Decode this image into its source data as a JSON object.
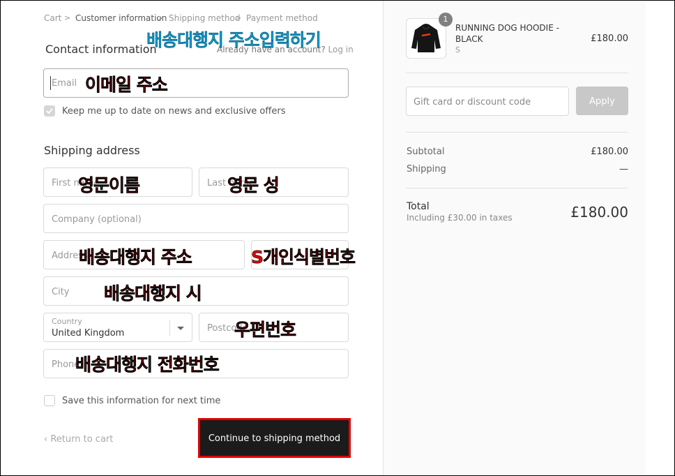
{
  "breadcrumb": {
    "items": [
      "Cart",
      "Customer information",
      "Shipping method",
      "Payment method"
    ],
    "separator": ">"
  },
  "contact": {
    "heading": "Contact information",
    "account_text": "Already have an account?",
    "login_link": "Log in",
    "email_placeholder": "Email",
    "newsletter_label": "Keep me up to date on news and exclusive offers",
    "newsletter_checked": true
  },
  "shipping": {
    "heading": "Shipping address",
    "first_name_placeholder": "First name",
    "last_name_placeholder": "Last name",
    "company_placeholder": "Company (optional)",
    "address_placeholder": "Address",
    "city_placeholder": "City",
    "country_label": "Country",
    "country_value": "United Kingdom",
    "postcode_placeholder": "Postcode",
    "phone_placeholder": "Phone",
    "save_label": "Save this information for next time"
  },
  "actions": {
    "return_label": "Return to cart",
    "continue_label": "Continue to shipping method"
  },
  "annotations": {
    "title": "배송대행지 주소입력하기",
    "email": "이메일 주소",
    "first_name": "영문이름",
    "last_name": "영문 성",
    "address": "배송대행지 주소",
    "apt": "S개인식별번호",
    "city": "배송대행지 시",
    "postcode": "우편번호",
    "phone": "배송대행지 전화번호"
  },
  "summary": {
    "product_name_line1": "RUNNING DOG HOODIE -",
    "product_name_line2": "BLACK",
    "product_variant": "S",
    "product_price": "£180.00",
    "quantity": "1",
    "discount_placeholder": "Gift card or discount code",
    "apply_label": "Apply",
    "subtotal_label": "Subtotal",
    "subtotal_value": "£180.00",
    "shipping_label": "Shipping",
    "shipping_value": "—",
    "total_label": "Total",
    "tax_note": "Including £30.00 in taxes",
    "total_value": "£180.00"
  },
  "colors": {
    "accent_red": "#e00000",
    "annotation_cyan": "#27b6e8",
    "button_dark": "#1b1b1b",
    "apply_disabled": "#c8c8c8"
  }
}
